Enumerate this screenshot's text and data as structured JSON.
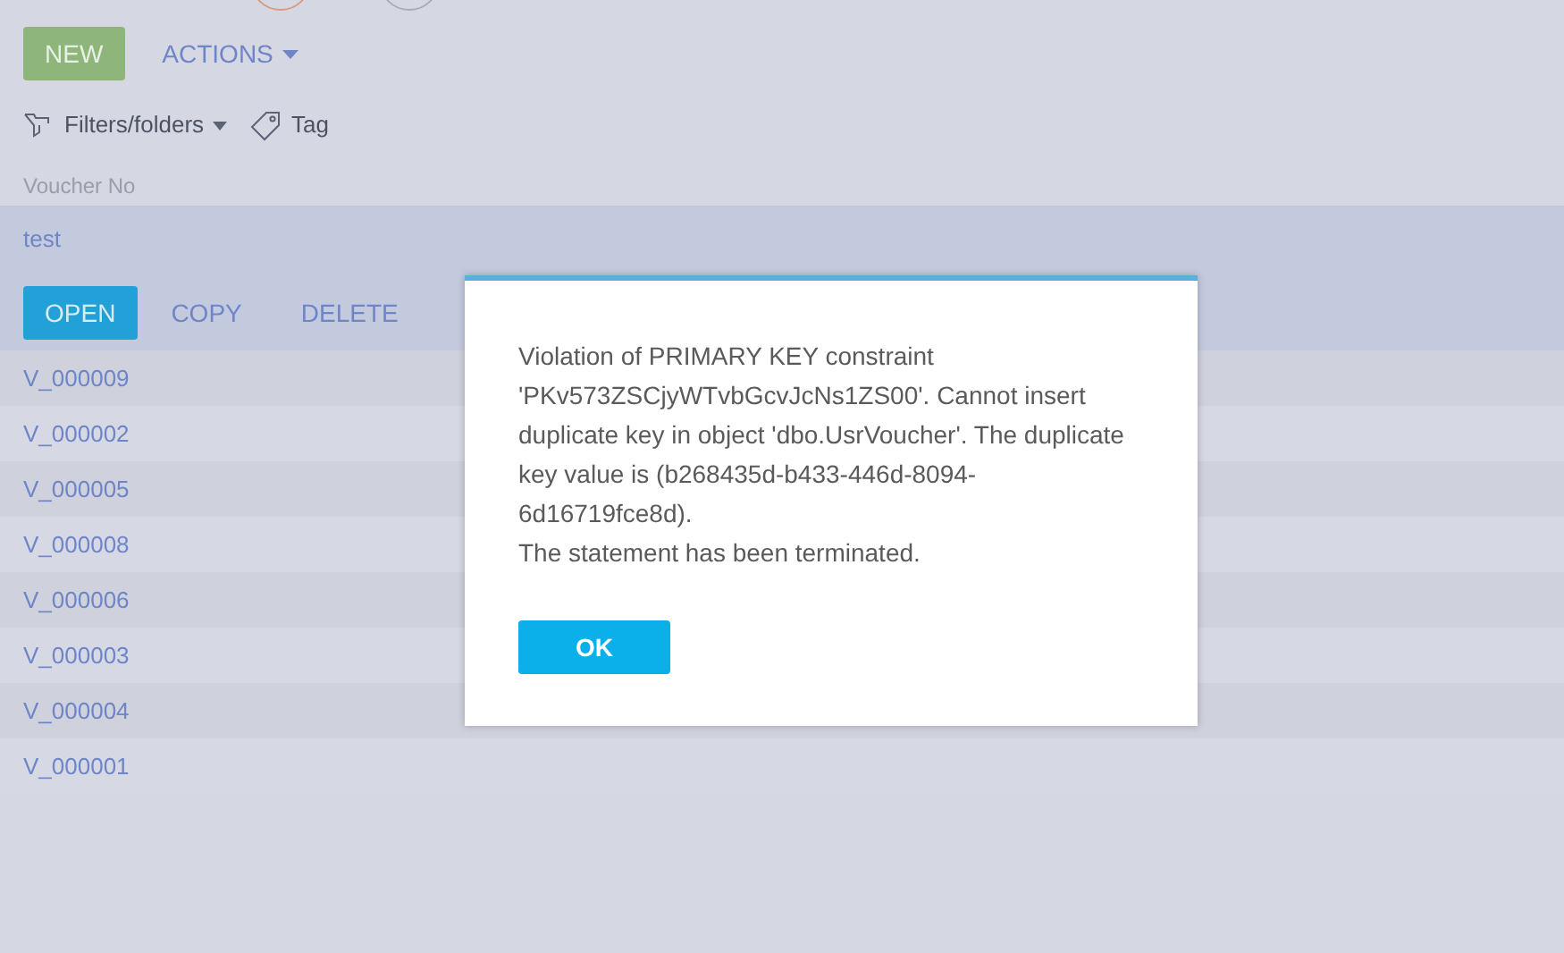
{
  "toolbar": {
    "new_button": "NEW",
    "actions_button": "ACTIONS"
  },
  "filters": {
    "filters_button": "Filters/folders",
    "tag_button": "Tag"
  },
  "table": {
    "columns": [
      "Voucher No"
    ],
    "rows": [
      {
        "voucher_no": "test",
        "selected": true
      },
      {
        "voucher_no": "V_000009",
        "selected": false
      },
      {
        "voucher_no": "V_000002",
        "selected": false
      },
      {
        "voucher_no": "V_000005",
        "selected": false
      },
      {
        "voucher_no": "V_000008",
        "selected": false
      },
      {
        "voucher_no": "V_000006",
        "selected": false
      },
      {
        "voucher_no": "V_000003",
        "selected": false
      },
      {
        "voucher_no": "V_000004",
        "selected": false
      },
      {
        "voucher_no": "V_000001",
        "selected": false
      }
    ],
    "row_actions": [
      {
        "label": "OPEN",
        "kind": "primary"
      },
      {
        "label": "COPY",
        "kind": "link"
      },
      {
        "label": "DELETE",
        "kind": "link"
      }
    ]
  },
  "dialog": {
    "message": [
      "Violation of PRIMARY KEY constraint 'PKv573ZSCjyWTvbGcvJcNs1ZS00'. Cannot insert duplicate key in object 'dbo.UsrVoucher'. The duplicate key value is (b268435d-b433-446d-8094-6d16719fce8d).",
      "The statement has been terminated."
    ],
    "ok_button": "OK"
  }
}
